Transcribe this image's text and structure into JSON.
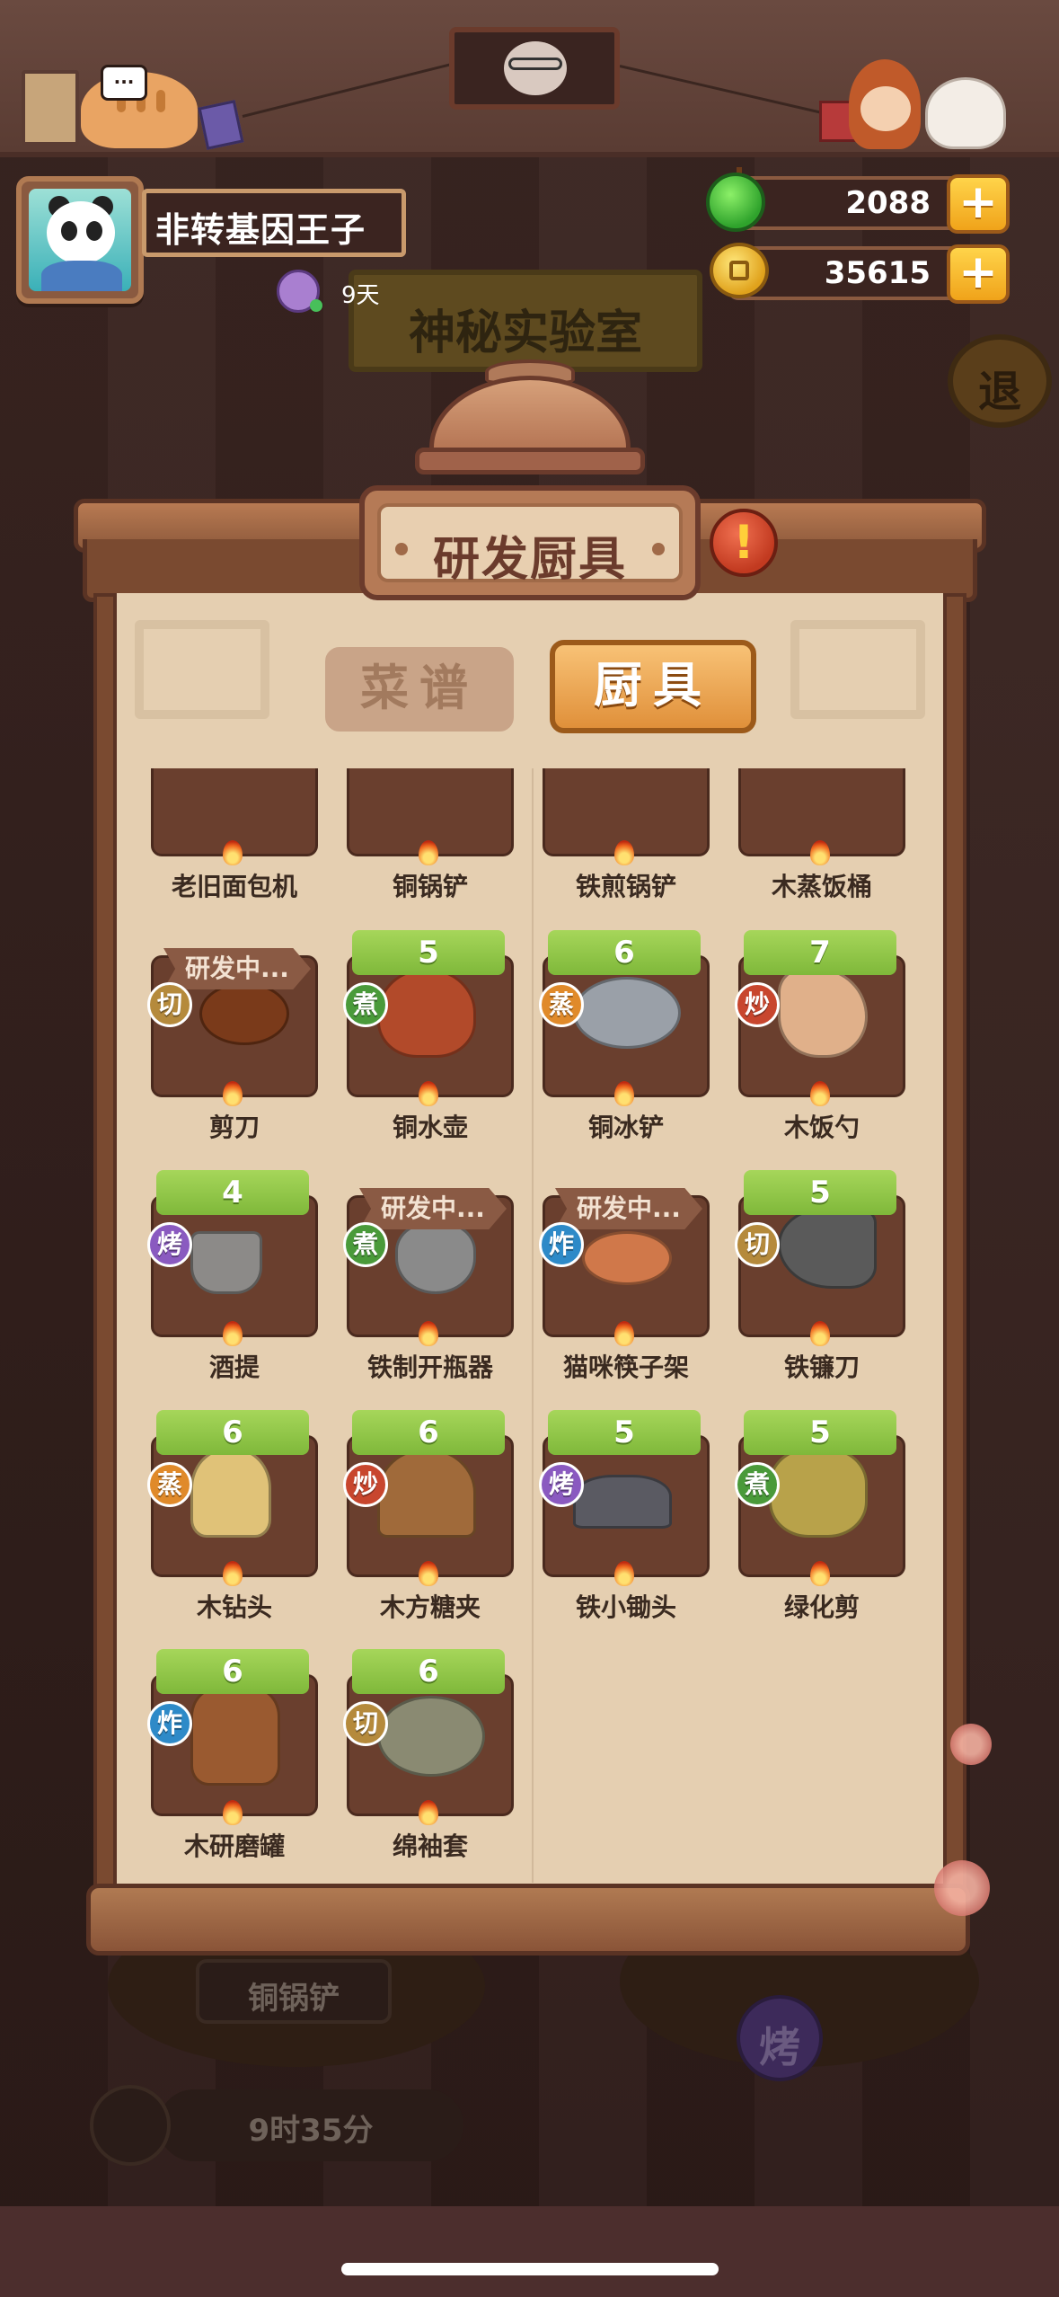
{
  "player": {
    "name": "非转基因王子",
    "vip_days": "9天"
  },
  "currency": {
    "gems": "2088",
    "coins": "35615",
    "plus": "+"
  },
  "background": {
    "lab_sign": "神秘实验室",
    "exit_button": "退",
    "slot_item": "铜锅铲",
    "timer": "9时35分",
    "roast_button": "烤"
  },
  "speech_bubble": "···",
  "panel": {
    "title": "研发厨具",
    "alert_mark": "!",
    "tabs": [
      {
        "label": "菜谱",
        "active": false
      },
      {
        "label": "厨具",
        "active": true
      }
    ]
  },
  "items": [
    {
      "name": "老旧面包机",
      "level": "",
      "status": "",
      "method": "",
      "icon": "bread-machine-icon"
    },
    {
      "name": "铜锅铲",
      "level": "",
      "status": "",
      "method": "",
      "icon": "copper-spatula-icon"
    },
    {
      "name": "铁煎锅铲",
      "level": "",
      "status": "",
      "method": "",
      "icon": "iron-frying-spatula-icon"
    },
    {
      "name": "木蒸饭桶",
      "level": "",
      "status": "",
      "method": "",
      "icon": "wooden-rice-steamer-icon"
    },
    {
      "name": "剪刀",
      "level": "",
      "status": "研发中...",
      "method": "切",
      "icon": "scissors-icon"
    },
    {
      "name": "铜水壶",
      "level": "5",
      "status": "",
      "method": "煮",
      "icon": "copper-kettle-icon"
    },
    {
      "name": "铜冰铲",
      "level": "6",
      "status": "",
      "method": "蒸",
      "icon": "copper-ice-scoop-icon"
    },
    {
      "name": "木饭勺",
      "level": "7",
      "status": "",
      "method": "炒",
      "icon": "wooden-rice-paddle-icon"
    },
    {
      "name": "酒提",
      "level": "4",
      "status": "",
      "method": "烤",
      "icon": "wine-ladle-icon"
    },
    {
      "name": "铁制开瓶器",
      "level": "",
      "status": "研发中...",
      "method": "煮",
      "icon": "iron-bottle-opener-icon"
    },
    {
      "name": "猫咪筷子架",
      "level": "",
      "status": "研发中...",
      "method": "炸",
      "icon": "cat-chopstick-rest-icon"
    },
    {
      "name": "铁镰刀",
      "level": "5",
      "status": "",
      "method": "切",
      "icon": "iron-sickle-icon"
    },
    {
      "name": "木钻头",
      "level": "6",
      "status": "",
      "method": "蒸",
      "icon": "wooden-drill-bit-icon"
    },
    {
      "name": "木方糖夹",
      "level": "6",
      "status": "",
      "method": "炒",
      "icon": "wooden-sugar-tongs-icon"
    },
    {
      "name": "铁小锄头",
      "level": "5",
      "status": "",
      "method": "烤",
      "icon": "iron-small-hoe-icon"
    },
    {
      "name": "绿化剪",
      "level": "5",
      "status": "",
      "method": "煮",
      "icon": "garden-shears-icon"
    },
    {
      "name": "木研磨罐",
      "level": "6",
      "status": "",
      "method": "炸",
      "icon": "wooden-grinder-icon"
    },
    {
      "name": "绵袖套",
      "level": "6",
      "status": "",
      "method": "切",
      "icon": "cotton-sleeve-icon"
    }
  ],
  "method_colors": {
    "切": "#b58a3c",
    "煮": "#4a9a3a",
    "蒸": "#e08a2a",
    "炒": "#c8462e",
    "烤": "#8a5ac0",
    "炸": "#2e8ac8"
  }
}
